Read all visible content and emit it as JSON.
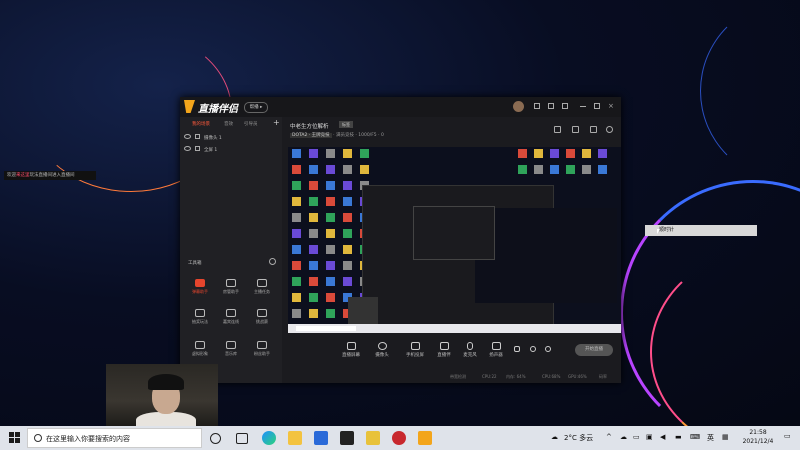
{
  "desktop": {
    "tooltip_prefix": "欢迎",
    "tooltip_highlight": "来这里",
    "tooltip_suffix": "玩法直播间进入直播间",
    "float_box_label": "顺时针"
  },
  "app": {
    "title": "直播伴侣",
    "version": "帮播 ▸",
    "left_tabs": [
      "我的场景",
      "音效",
      "引导员"
    ],
    "scenes": [
      "摄像头 1",
      "全屏 1"
    ],
    "tools_title": "工具箱",
    "tools": [
      {
        "label": "弹幕助手",
        "active": true
      },
      {
        "label": "房管助手",
        "active": false
      },
      {
        "label": "主播任务",
        "active": false
      },
      {
        "label": "抽奖玩法",
        "active": false
      },
      {
        "label": "嘉宾连线",
        "active": false
      },
      {
        "label": "挑战赛",
        "active": false
      },
      {
        "label": "虚拟形象",
        "active": false
      },
      {
        "label": "音乐库",
        "active": false
      },
      {
        "label": "粉丝助手",
        "active": false
      }
    ],
    "scene_title": "中老生方位解析",
    "scene_tag": "标签",
    "sub_chip": "DOTA2 · 王牌竞技",
    "sub_rest": "· 满员竞技 · 1000/F5 · 0",
    "bottom_buttons": [
      "直播屏幕",
      "摄像头",
      "手机投屏",
      "直播伴",
      "麦克风",
      "扬声器"
    ],
    "start_label": "开始直播",
    "status": [
      "带宽检测",
      "CPU:22",
      "内存: 64%",
      "CPU:68%",
      "GPU:46%",
      "码率"
    ]
  },
  "taskbar": {
    "search_placeholder": "在这里输入你要搜索的内容",
    "weather": "2°C 多云",
    "ime": "英",
    "time": "21:58",
    "date": "2021/12/4"
  }
}
